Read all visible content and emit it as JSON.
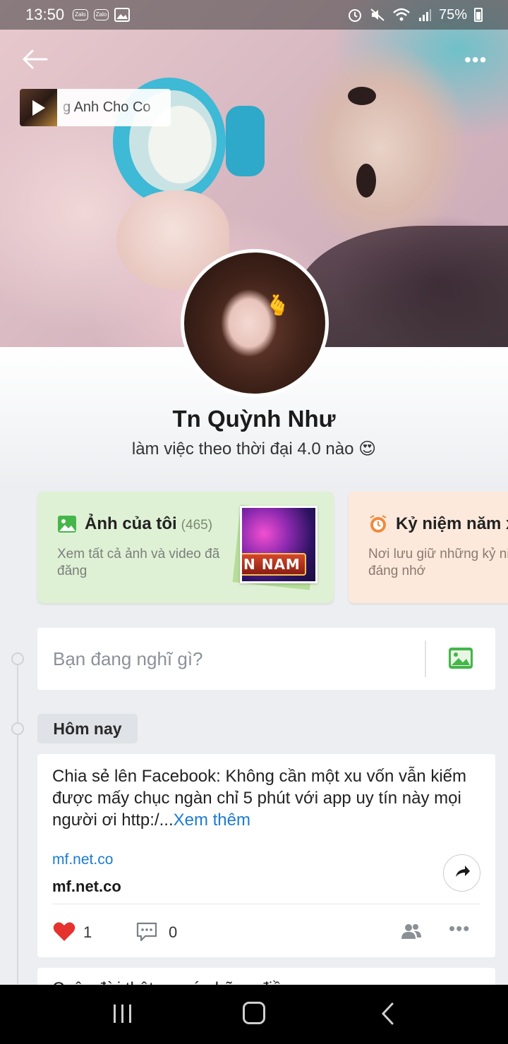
{
  "status_bar": {
    "time": "13:50",
    "badges": [
      "Zalo",
      "Zalo"
    ],
    "battery": "75%"
  },
  "music": {
    "title": "g Anh Cho Co"
  },
  "profile": {
    "name": "Tn Quỳnh Như",
    "status": "làm việc theo thời đại 4.0 nào 😍"
  },
  "cards": {
    "photos": {
      "title": "Ảnh của tôi",
      "count": "(465)",
      "desc": "Xem tất cả ảnh và video đã đăng",
      "thumb_text": "N NAM"
    },
    "memory": {
      "title": "Kỷ niệm năm x",
      "desc": "Nơi lưu giữ những kỷ niệm đáng nhớ"
    }
  },
  "composer": {
    "placeholder": "Bạn đang nghĩ gì?"
  },
  "timeline": {
    "date_label": "Hôm nay"
  },
  "post": {
    "text": "Chia sẻ lên Facebook: Không cần một xu vốn vẫn kiếm được mấy chục ngàn chỉ 5 phút với app uy tín này mọi người ơi http:/...",
    "see_more": "Xem thêm",
    "link_url": "mf.net.co",
    "link_title": "mf.net.co",
    "likes": "1",
    "comments": "0"
  },
  "next_post": {
    "text": "Cuộc đời thật sự có những điều"
  },
  "colors": {
    "link_blue": "#1b7bd4",
    "photo_card_bg": "#dff1d5",
    "memory_card_bg": "#fde9dc",
    "like_red": "#e5322d",
    "photo_icon_green": "#45b649",
    "memory_icon_orange": "#f08a3c"
  },
  "icons": [
    "back-arrow-icon",
    "more-icon",
    "play-icon",
    "image-icon",
    "clock-icon",
    "heart-icon",
    "comment-icon",
    "share-icon",
    "friends-icon",
    "alarm-icon",
    "mute-icon",
    "wifi-icon",
    "signal-icon",
    "battery-icon"
  ]
}
